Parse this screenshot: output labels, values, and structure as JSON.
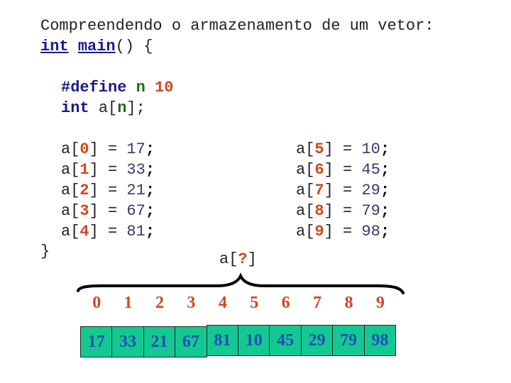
{
  "title": "Compreendendo o armazenamento de um vetor:",
  "main_signature": {
    "type": "int",
    "name": "main",
    "rest": "() {"
  },
  "define_line": {
    "keyword": "#define",
    "name": "n",
    "value": "10"
  },
  "decl_line": {
    "type": "int",
    "var_prefix": "a[",
    "size": "n",
    "suffix": "];"
  },
  "closing_brace": "}",
  "assignments_left": [
    {
      "index": "0",
      "value": "17"
    },
    {
      "index": "1",
      "value": "33"
    },
    {
      "index": "2",
      "value": "21"
    },
    {
      "index": "3",
      "value": "67"
    },
    {
      "index": "4",
      "value": "81"
    }
  ],
  "assignments_right": [
    {
      "index": "5",
      "value": "10"
    },
    {
      "index": "6",
      "value": "45"
    },
    {
      "index": "7",
      "value": "29"
    },
    {
      "index": "8",
      "value": "79"
    },
    {
      "index": "9",
      "value": "98"
    }
  ],
  "tokens": {
    "array": "a",
    "open": "[",
    "close": "]",
    "eq": "=",
    "semi": ";"
  },
  "brace_label": {
    "prefix": "a[",
    "index": "?",
    "suffix": "]"
  },
  "diagram": {
    "indices": [
      "0",
      "1",
      "2",
      "3",
      "4",
      "5",
      "6",
      "7",
      "8",
      "9"
    ],
    "values": [
      "17",
      "33",
      "21",
      "67",
      "81",
      "10",
      "45",
      "29",
      "79",
      "98"
    ]
  },
  "colors": {
    "cell_fill": "#14c891",
    "cell_text": "#1f4fb8",
    "index_text": "#d2461e",
    "keyword": "#1a1a8c",
    "identifier": "#1a6b1a"
  }
}
